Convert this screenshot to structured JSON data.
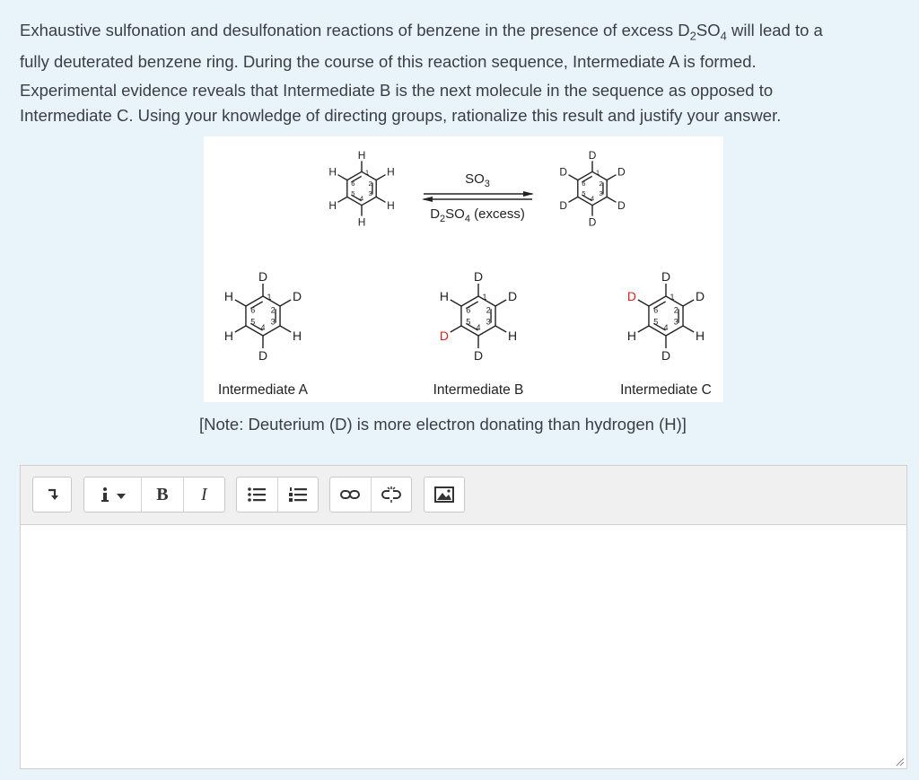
{
  "question": {
    "p1_line1": [
      "Exhaustive sulfonation and desulfonation reactions of benzene in the presence of excess D",
      "2",
      "SO",
      "4",
      " will lead to a"
    ],
    "p1_line2": "fully deuterated benzene ring. During the course of this reaction sequence, Intermediate A is formed.",
    "p2_line1": "Experimental evidence reveals that Intermediate B is the next molecule in the sequence as opposed to",
    "p2_line2": "Intermediate C. Using your knowledge of directing groups, rationalize this result and justify your answer."
  },
  "figure": {
    "reaction": {
      "reagent_top": [
        "SO",
        "3"
      ],
      "reagent_bottom": [
        "D",
        "2",
        "SO",
        "4",
        " (excess)"
      ]
    },
    "atom_labels": {
      "H": "H",
      "D": "D"
    },
    "position_numbers": [
      "1",
      "2",
      "3",
      "4",
      "5",
      "6"
    ],
    "molecules": {
      "reactant": [
        "H",
        "H",
        "H",
        "H",
        "H",
        "H"
      ],
      "product": [
        "D",
        "D",
        "D",
        "D",
        "D",
        "D"
      ],
      "intermediate_a": [
        "D",
        "D",
        "H",
        "D",
        "H",
        "H"
      ],
      "intermediate_b": [
        "D",
        "D",
        "H",
        "D",
        "D",
        "H"
      ],
      "intermediate_c": [
        "D",
        "D",
        "H",
        "D",
        "H",
        "D"
      ]
    },
    "highlight_color": "#e02020",
    "captions": {
      "a": "Intermediate A",
      "b": "Intermediate B",
      "c": "Intermediate C"
    }
  },
  "note": "[Note: Deuterium (D) is more electron donating than hydrogen (H)]",
  "editor": {
    "toolbar": {
      "collapse_icon": "collapse-toolbar-icon",
      "info_icon": "info-dropdown-icon",
      "bold_label": "B",
      "italic_label": "I",
      "bullet_list_icon": "unordered-list-icon",
      "numbered_list_icon": "ordered-list-icon",
      "link_icon": "link-icon",
      "unlink_icon": "unlink-icon",
      "image_icon": "image-icon"
    },
    "content": ""
  }
}
